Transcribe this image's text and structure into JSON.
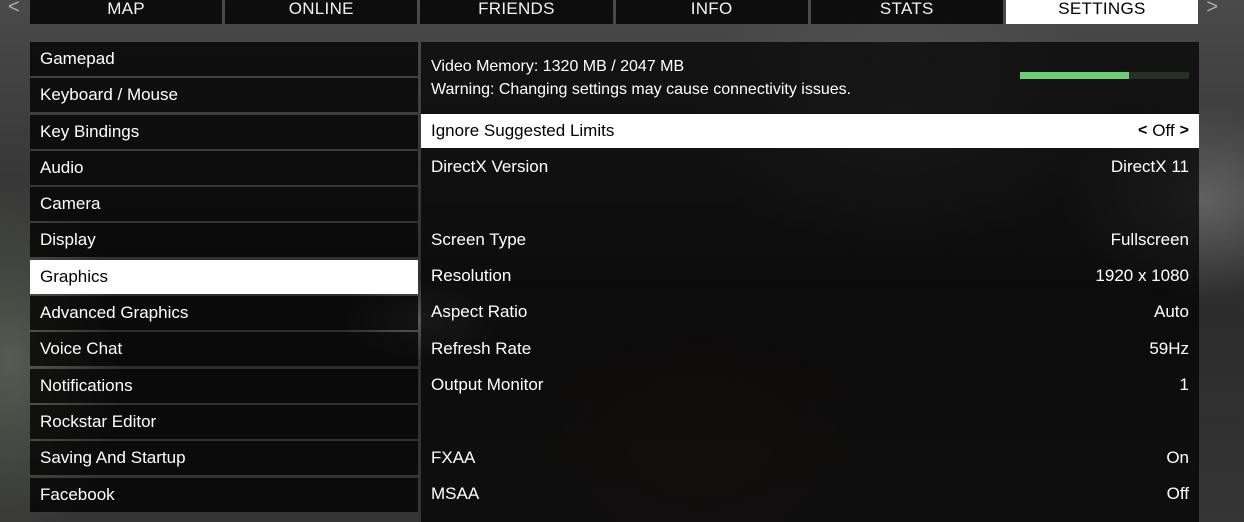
{
  "nav": {
    "prev_arrow": "<",
    "next_arrow": ">"
  },
  "tabs": [
    "MAP",
    "ONLINE",
    "FRIENDS",
    "INFO",
    "STATS",
    "SETTINGS"
  ],
  "active_tab": "SETTINGS",
  "sidebar": {
    "items": [
      {
        "label": "Gamepad"
      },
      {
        "label": "Keyboard / Mouse"
      },
      {
        "label": "Key Bindings"
      },
      {
        "label": "Audio"
      },
      {
        "label": "Camera"
      },
      {
        "label": "Display"
      },
      {
        "label": "Graphics"
      },
      {
        "label": "Advanced Graphics"
      },
      {
        "label": "Voice Chat"
      },
      {
        "label": "Notifications"
      },
      {
        "label": "Rockstar Editor"
      },
      {
        "label": "Saving And Startup"
      },
      {
        "label": "Facebook"
      }
    ],
    "selected": "Graphics"
  },
  "graphics": {
    "video_memory": "Video Memory: 1320 MB / 2047 MB",
    "video_memory_fraction": 0.645,
    "warning": "Warning: Changing settings may cause connectivity issues.",
    "settings": [
      {
        "label": "Ignore Suggested Limits",
        "value": "Off",
        "selected": true,
        "chevron_left": "<",
        "chevron_right": ">"
      },
      {
        "label": "DirectX Version",
        "value": "DirectX 11"
      },
      {
        "label": "Screen Type",
        "value": "Fullscreen"
      },
      {
        "label": "Resolution",
        "value": "1920 x 1080"
      },
      {
        "label": "Aspect Ratio",
        "value": "Auto"
      },
      {
        "label": "Refresh Rate",
        "value": "59Hz"
      },
      {
        "label": "Output Monitor",
        "value": "1"
      },
      {
        "label": "FXAA",
        "value": "On"
      },
      {
        "label": "MSAA",
        "value": "Off"
      }
    ]
  },
  "colors": {
    "accent_green": "#6dcf74",
    "selected_bg": "#ffffff",
    "panel_bg": "#000000"
  }
}
